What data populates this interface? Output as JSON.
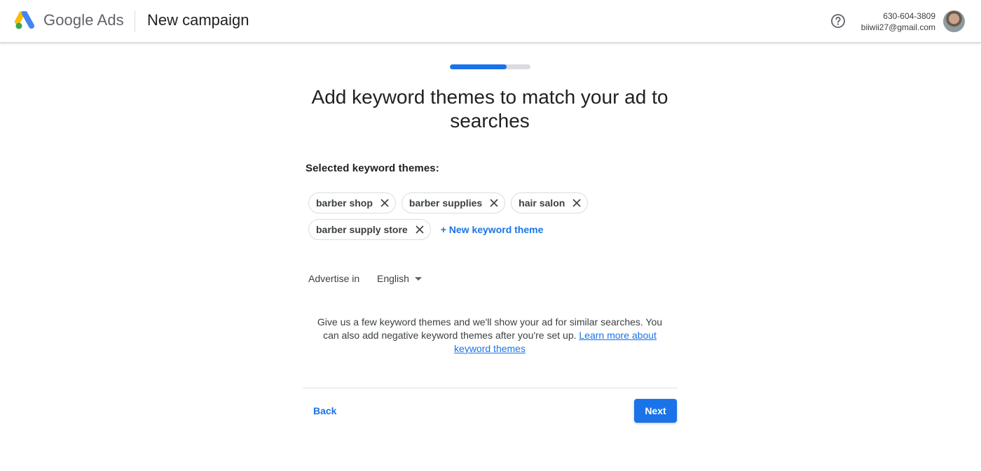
{
  "header": {
    "brand": "Google Ads",
    "page_name": "New campaign",
    "help_icon": "help-circle-icon",
    "account": {
      "phone": "630-604-3809",
      "email": "biiwii27@gmail.com"
    }
  },
  "progress": {
    "percent": 70
  },
  "main": {
    "title": "Add keyword themes to match your ad to searches",
    "selected_label": "Selected keyword themes:",
    "keyword_themes": [
      {
        "label": "barber shop"
      },
      {
        "label": "barber supplies"
      },
      {
        "label": "hair salon"
      },
      {
        "label": "barber supply store"
      }
    ],
    "new_keyword_label": "+ New keyword theme",
    "advertise_label": "Advertise in",
    "language": "English",
    "help_text": "Give us a few keyword themes and we'll show your ad for similar searches. You can also add negative keyword themes after you're set up. ",
    "learn_more_link": "Learn more about keyword themes"
  },
  "footer": {
    "back_label": "Back",
    "next_label": "Next"
  },
  "colors": {
    "accent": "#1a73e8",
    "progress_track": "#dadce0",
    "text": "#202124"
  }
}
